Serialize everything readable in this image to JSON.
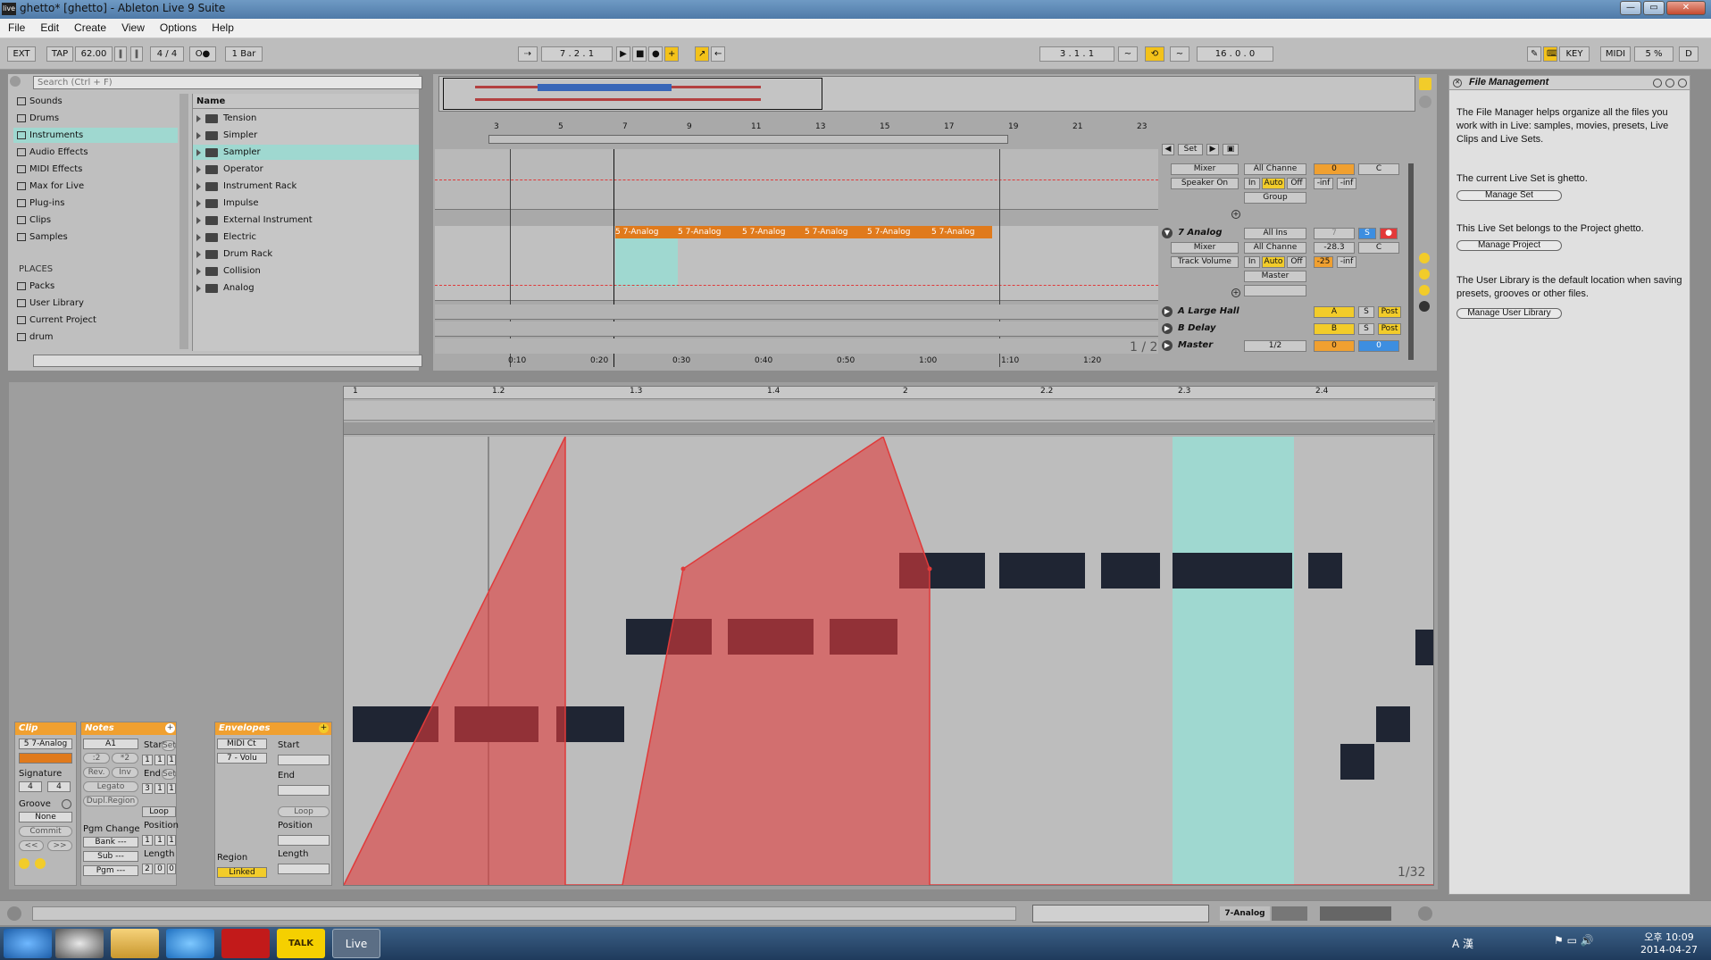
{
  "window": {
    "title": "ghetto*  [ghetto] - Ableton Live 9 Suite",
    "logo": "live",
    "buttons": [
      "—",
      "▭",
      "✕"
    ]
  },
  "menu": [
    "File",
    "Edit",
    "Create",
    "View",
    "Options",
    "Help"
  ],
  "controlbar": {
    "ext": "EXT",
    "tap": "TAP",
    "tempo": "62.00",
    "signature": "4 / 4",
    "metronome": "O●",
    "quantize": "1 Bar",
    "position": "7 .   2 .   1",
    "loop_start": "3 .   1 .   1",
    "loop_length": "16 .   0 .   0",
    "key": "KEY",
    "midi": "MIDI",
    "cpu": "5 %",
    "d": "D"
  },
  "browser": {
    "search_placeholder": "Search (Ctrl + F)",
    "categories": [
      "Sounds",
      "Drums",
      "Instruments",
      "Audio Effects",
      "MIDI Effects",
      "Max for Live",
      "Plug-ins",
      "Clips",
      "Samples"
    ],
    "places_label": "PLACES",
    "places": [
      "Packs",
      "User Library",
      "Current Project",
      "drum"
    ],
    "column_header": "Name",
    "items": [
      "Tension",
      "Simpler",
      "Sampler",
      "Operator",
      "Instrument Rack",
      "Impulse",
      "External Instrument",
      "Electric",
      "Drum Rack",
      "Collision",
      "Analog"
    ],
    "selected_category": "Instruments",
    "selected_item": "Sampler"
  },
  "arrangement": {
    "bar_ruler": [
      "3",
      "5",
      "7",
      "9",
      "11",
      "13",
      "15",
      "17",
      "19",
      "21",
      "23"
    ],
    "time_ruler": [
      "0:10",
      "0:20",
      "0:30",
      "0:40",
      "0:50",
      "1:00",
      "1:10",
      "1:20"
    ],
    "set_label": "Set",
    "page": "1 / 2",
    "clip_label": "5 7-Analog",
    "tracks": {
      "top": {
        "io1": "Mixer",
        "io2": "Speaker On",
        "input": "All Channe",
        "group": "Group",
        "vol": "0",
        "pan": "C",
        "in": "In",
        "auto": "Auto",
        "off": "Off",
        "inf1": "-inf",
        "inf2": "-inf"
      },
      "analog": {
        "name": "7 Analog",
        "input": "All Ins",
        "ch": "All Channe",
        "mixer": "Mixer",
        "param": "Track Volume",
        "in": "In",
        "auto": "Auto",
        "off": "Off",
        "out": "Master",
        "num": "7",
        "s": "S",
        "rec": "●",
        "vol": "-28.3",
        "pan": "C",
        "v2": "-25",
        "inf": "-inf"
      },
      "large_hall": {
        "name": "A Large Hall",
        "send": "A",
        "s": "S",
        "post": "Post"
      },
      "delay": {
        "name": "B Delay",
        "send": "B",
        "s": "S",
        "post": "Post"
      },
      "master": {
        "name": "Master",
        "out": "1/2",
        "vol": "0",
        "pan": "0"
      }
    }
  },
  "clip": {
    "header": "Clip",
    "name": "5 7-Analog",
    "signature_label": "Signature",
    "sig_num": "4",
    "sig_den": "4",
    "groove_label": "Groove",
    "groove": "None",
    "commit": "Commit",
    "nav_prev": "<<",
    "nav_next": ">>"
  },
  "notes": {
    "header": "Notes",
    "key": "A1",
    "half": ":2",
    "double": "*2",
    "rev": "Rev.",
    "inv": "Inv",
    "legato": "Legato",
    "dupl": "Dupl.Region",
    "start_label": "Start",
    "end_label": "End",
    "set": "Set",
    "start": [
      "1",
      "1",
      "1"
    ],
    "end": [
      "3",
      "1",
      "1"
    ],
    "loop": "Loop",
    "position_label": "Position",
    "position": [
      "1",
      "1",
      "1"
    ],
    "length_label": "Length",
    "length": [
      "2",
      "0",
      "0"
    ],
    "pgm_label": "Pgm Change",
    "bank": "Bank ---",
    "sub": "Sub ---",
    "pgm": "Pgm ---"
  },
  "envelopes": {
    "header": "Envelopes",
    "device": "MIDI Ct",
    "control": "7 - Volu",
    "region_label": "Region",
    "linked": "Linked",
    "start_label": "Start",
    "end_label": "End",
    "loop": "Loop",
    "position_label": "Position",
    "length_label": "Length"
  },
  "editor": {
    "ruler": [
      "1",
      "1.2",
      "1.3",
      "1.4",
      "2",
      "2.2",
      "2.3",
      "2.4"
    ],
    "grid": "1/32",
    "envelope_color": "#e03a3a"
  },
  "info": {
    "title": "File Management",
    "p1": "The File Manager helps organize all the files you work with in Live: samples, movies, presets, Live Clips and Live Sets.",
    "p2": "The current Live Set is ghetto.",
    "b1": "Manage Set",
    "p3": "This Live Set belongs to the Project ghetto.",
    "b2": "Manage Project",
    "p4": "The User Library is the default location when saving presets, grooves or other files.",
    "b3": "Manage User Library"
  },
  "status": {
    "track": "7-Analog"
  },
  "taskbar": {
    "time": "오후 10:09",
    "date": "2014-04-27",
    "ime": "A 漢",
    "apps": [
      "start",
      "chrome",
      "explorer",
      "ie",
      "acrobat",
      "kakaotalk",
      "live"
    ],
    "live_label": "Live",
    "talk_label": "TALK"
  }
}
